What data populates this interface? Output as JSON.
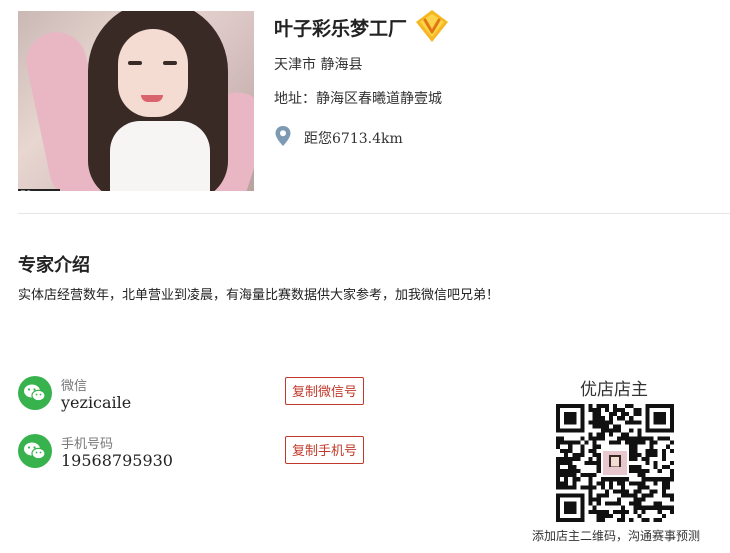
{
  "shop": {
    "name": "叶子彩乐梦工厂",
    "region": "天津市 静海县",
    "address": "地址：静海区春曦道静壹城",
    "distance": "距您6713.4km",
    "photo_sign": "ES"
  },
  "intro": {
    "title": "专家介绍",
    "description": "实体店经营数年，北单营业到凌晨，有海量比赛数据供大家参考，加我微信吧兄弟！"
  },
  "contacts": [
    {
      "label": "微信",
      "value": "yezicaile",
      "button": "复制微信号"
    },
    {
      "label": "手机号码",
      "value": "19568795930",
      "button": "复制手机号"
    }
  ],
  "qr": {
    "title": "优店店主",
    "caption": "添加店主二维码，沟通赛事预测"
  },
  "colors": {
    "accent_red": "#c0392b",
    "wechat_green": "#37b24d",
    "vip_gold": "#f5b820"
  }
}
